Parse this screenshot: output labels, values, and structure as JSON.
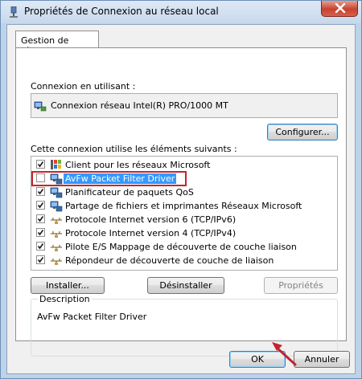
{
  "window": {
    "title": "Propriétés de Connexion au réseau local",
    "close_icon": "close-icon"
  },
  "tabs": [
    {
      "label": "Gestion de réseau",
      "active": true
    }
  ],
  "connection": {
    "label": "Connexion en utilisant :",
    "adapter_name": "Connexion réseau Intel(R) PRO/1000 MT",
    "adapter_icon": "network-adapter-icon",
    "configure_label": "Configurer..."
  },
  "components": {
    "label": "Cette connexion utilise les éléments suivants :",
    "items": [
      {
        "label": "Client pour les réseaux Microsoft",
        "checked": true,
        "icon": "network-client-icon"
      },
      {
        "label": "AvFw Packet Filter Driver",
        "checked": false,
        "icon": "network-adapter-icon",
        "selected": true
      },
      {
        "label": "Planificateur de paquets QoS",
        "checked": true,
        "icon": "network-adapter-icon"
      },
      {
        "label": "Partage de fichiers et imprimantes Réseaux Microsoft",
        "checked": true,
        "icon": "network-adapter-icon"
      },
      {
        "label": "Protocole Internet version 6 (TCP/IPv6)",
        "checked": true,
        "icon": "protocol-icon"
      },
      {
        "label": "Protocole Internet version 4 (TCP/IPv4)",
        "checked": true,
        "icon": "protocol-icon"
      },
      {
        "label": "Pilote E/S Mappage de découverte de couche liaison",
        "checked": true,
        "icon": "protocol-icon"
      },
      {
        "label": "Répondeur de découverte de couche de liaison",
        "checked": true,
        "icon": "protocol-icon"
      }
    ]
  },
  "actions": {
    "install_label": "Installer...",
    "uninstall_label": "Désinstaller",
    "properties_label": "Propriétés"
  },
  "description": {
    "legend": "Description",
    "text": "AvFw Packet Filter Driver"
  },
  "footer": {
    "ok_label": "OK",
    "cancel_label": "Annuler"
  },
  "colors": {
    "highlight_border": "#c1272d",
    "selection": "#3399ff",
    "arrow": "#c1272d"
  }
}
